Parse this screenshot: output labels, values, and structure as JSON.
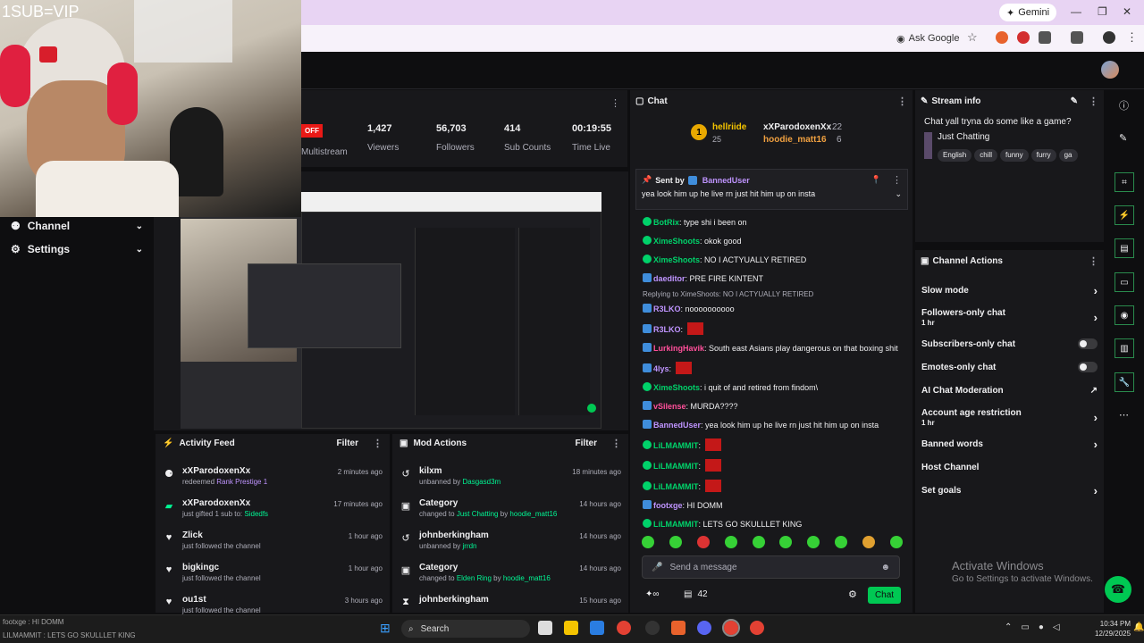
{
  "browser": {
    "gemini_label": "Gemini",
    "ask_google_label": "Ask Google"
  },
  "overlay": {
    "sub_vip": "1SUB=VIP"
  },
  "sidebar": {
    "items": [
      {
        "label": "Channel"
      },
      {
        "label": "Settings"
      }
    ]
  },
  "stats": {
    "offline_badge": "OFF",
    "multistream_label": "Multistream",
    "items": [
      {
        "value": "1,427",
        "label": "Viewers"
      },
      {
        "value": "56,703",
        "label": "Followers"
      },
      {
        "value": "414",
        "label": "Sub Counts"
      },
      {
        "value": "00:19:55",
        "label": "Time Live"
      }
    ]
  },
  "activity_feed": {
    "title": "Activity Feed",
    "filter_label": "Filter",
    "rows": [
      {
        "name": "xXParodoxenXx",
        "pre": "redeemed ",
        "hl": "Rank Prestige 1",
        "post": "",
        "time": "2 minutes ago"
      },
      {
        "name": "xXParodoxenXx",
        "pre": "just gifted 1 sub to: ",
        "hl": "Sidedfs",
        "post": "",
        "time": "17 minutes ago"
      },
      {
        "name": "Zlick",
        "pre": "just followed the channel",
        "hl": "",
        "post": "",
        "time": "1 hour ago"
      },
      {
        "name": "bigkingc",
        "pre": "just followed the channel",
        "hl": "",
        "post": "",
        "time": "1 hour ago"
      },
      {
        "name": "ou1st",
        "pre": "just followed the channel",
        "hl": "",
        "post": "",
        "time": "3 hours ago"
      }
    ]
  },
  "mod_actions": {
    "title": "Mod Actions",
    "filter_label": "Filter",
    "rows": [
      {
        "name": "kilxm",
        "pre": "unbanned by ",
        "hl": "Dasgasd3m",
        "mid": "",
        "hl2": "",
        "time": "18 minutes ago"
      },
      {
        "name": "Category",
        "pre": "changed to ",
        "hl": "Just Chatting",
        "mid": " by ",
        "hl2": "hoodie_matt16",
        "time": "14 hours ago"
      },
      {
        "name": "johnberkingham",
        "pre": "unbanned by ",
        "hl": "jrrdn",
        "mid": "",
        "hl2": "",
        "time": "14 hours ago"
      },
      {
        "name": "Category",
        "pre": "changed to ",
        "hl": "Elden Ring",
        "mid": " by ",
        "hl2": "hoodie_matt16",
        "time": "14 hours ago"
      },
      {
        "name": "johnberkingham",
        "pre": "",
        "hl": "",
        "mid": "",
        "hl2": "",
        "time": "15 hours ago"
      }
    ]
  },
  "chat": {
    "title": "Chat",
    "leaderboard": [
      {
        "rank": "1",
        "name": "hellriide",
        "count": "25"
      },
      {
        "name": "xXParodoxenXx",
        "count": "22"
      },
      {
        "name": "hoodie_matt16",
        "count": "6"
      }
    ],
    "pinned": {
      "sent_by_label": "Sent by",
      "user": "BannedUser",
      "text": "yea look him up he live rn just hit him up on insta"
    },
    "messages": [
      {
        "name": "BotRix",
        "color": "#00d26a",
        "text": "type shi i been on"
      },
      {
        "name": "XimeShoots",
        "color": "#00d26a",
        "text": "okok good"
      },
      {
        "name": "XimeShoots",
        "color": "#00d26a",
        "text": "NO I ACTYUALLY RETIRED"
      },
      {
        "name": "daeditor",
        "color": "#bf94ff",
        "text": "PRE FIRE KINTENT"
      },
      {
        "reply": "Replying to XimeShoots: NO I ACTYUALLY RETIRED",
        "name": "R3LKO",
        "color": "#bf94ff",
        "text": "noooooooooo"
      },
      {
        "name": "R3LKO",
        "color": "#bf94ff",
        "text": ""
      },
      {
        "name": "LurkingHavik",
        "color": "#ff4f9a",
        "text": "South east Asians play dangerous on that boxing shit"
      },
      {
        "name": "4lys",
        "color": "#bf94ff",
        "text": ""
      },
      {
        "name": "XimeShoots",
        "color": "#00d26a",
        "text": "i quit of and retired from findom\\"
      },
      {
        "name": "vSilense",
        "color": "#ff4f9a",
        "text": "MURDA????"
      },
      {
        "name": "BannedUser",
        "color": "#bf94ff",
        "text": "yea look him up he live rn just hit him up on insta"
      },
      {
        "name": "LiLMAMMIT",
        "color": "#00d26a",
        "text": ""
      },
      {
        "name": "LiLMAMMIT",
        "color": "#00d26a",
        "text": ""
      },
      {
        "name": "LiLMAMMIT",
        "color": "#00d26a",
        "text": ""
      },
      {
        "name": "footxge",
        "color": "#bf94ff",
        "text": "HI DOMM"
      },
      {
        "name": "LiLMAMMIT",
        "color": "#00d26a",
        "text": "LETS GO SKULLLET KING"
      }
    ],
    "input_placeholder": "Send a message",
    "points": "42",
    "chat_button": "Chat"
  },
  "stream_info": {
    "title": "Stream info",
    "stream_title": "Chat yall tryna do some like a game?",
    "category": "Just Chatting",
    "tags": [
      "English",
      "chill",
      "funny",
      "furry",
      "ga"
    ]
  },
  "channel_actions": {
    "title": "Channel Actions",
    "rows": [
      {
        "label": "Slow mode",
        "sub": "",
        "ctrl": "chev"
      },
      {
        "label": "Followers-only chat",
        "sub": "1 hr",
        "ctrl": "chev"
      },
      {
        "label": "Subscribers-only chat",
        "sub": "",
        "ctrl": "toggle"
      },
      {
        "label": "Emotes-only chat",
        "sub": "",
        "ctrl": "toggle"
      },
      {
        "label": "AI Chat Moderation",
        "sub": "",
        "ctrl": "ext"
      },
      {
        "label": "Account age restriction",
        "sub": "1 hr",
        "ctrl": "chev"
      },
      {
        "label": "Banned words",
        "sub": "",
        "ctrl": "chev"
      },
      {
        "label": "Host Channel",
        "sub": "",
        "ctrl": ""
      },
      {
        "label": "Set goals",
        "sub": "",
        "ctrl": "chev"
      }
    ]
  },
  "watermark": {
    "title": "Activate Windows",
    "sub": "Go to Settings to activate Windows."
  },
  "taskbar": {
    "search_label": "Search",
    "time": "10:34 PM",
    "date": "12/29/2025"
  },
  "bottom_overlay": {
    "line1": "footxge : HI DOMM",
    "line2": "LILMAMMIT : LETS GO SKULLLET KING"
  },
  "colors": {
    "accent_green": "#00c853",
    "bg": "#0e0e10",
    "panel": "#18181b",
    "purple": "#bf94ff"
  }
}
